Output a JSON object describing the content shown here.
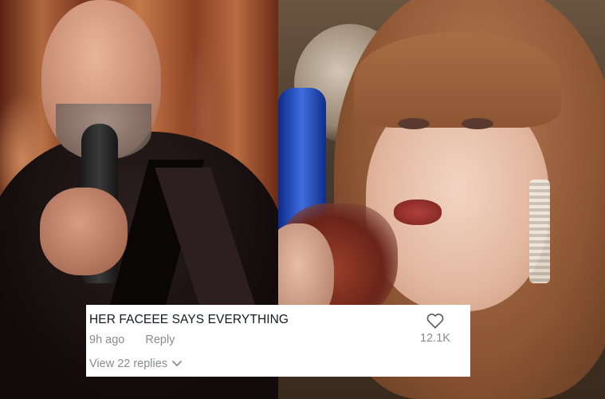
{
  "comment": {
    "text": "HER FACEEE SAYS EVERYTHING",
    "time": "9h ago",
    "reply_label": "Reply",
    "view_replies_label": "View 22 replies",
    "like_count": "12.1K",
    "icons": {
      "like": "heart-outline-icon",
      "expand": "chevron-down-icon"
    }
  },
  "colors": {
    "card_background": "#ffffff",
    "primary_text": "#161823",
    "secondary_text": "#8a8b91"
  }
}
